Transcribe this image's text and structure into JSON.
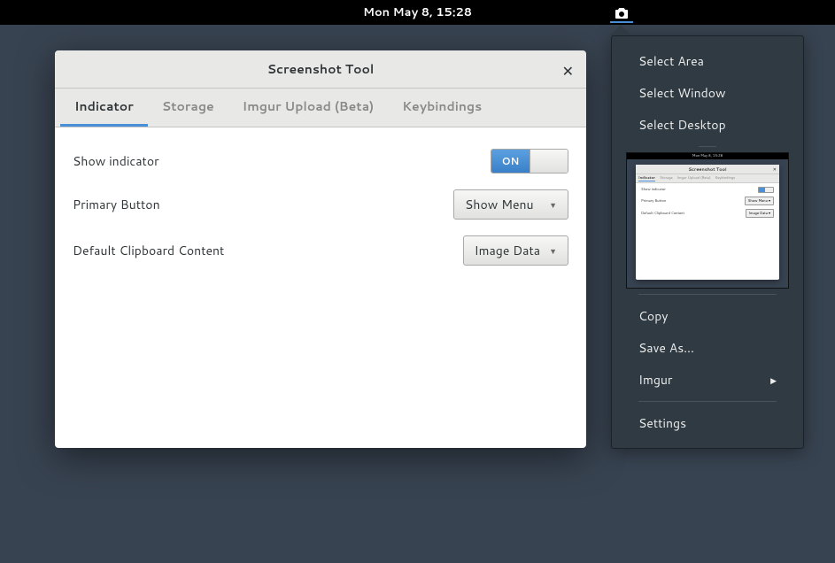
{
  "topbar": {
    "datetime": "Mon May  8, 15:28"
  },
  "window": {
    "title": "Screenshot Tool",
    "tabs": [
      {
        "label": "Indicator",
        "active": true
      },
      {
        "label": "Storage",
        "active": false
      },
      {
        "label": "Imgur Upload (Beta)",
        "active": false
      },
      {
        "label": "Keybindings",
        "active": false
      }
    ],
    "rows": {
      "show_indicator": {
        "label": "Show indicator",
        "value": "ON"
      },
      "primary_button": {
        "label": "Primary Button",
        "value": "Show Menu"
      },
      "clipboard": {
        "label": "Default Clipboard Content",
        "value": "Image Data"
      }
    }
  },
  "popup": {
    "select_area": "Select Area",
    "select_window": "Select Window",
    "select_desktop": "Select Desktop",
    "copy": "Copy",
    "save_as": "Save As...",
    "imgur": "Imgur",
    "settings": "Settings",
    "preview": {
      "datetime": "Mon May 8, 15:28",
      "title": "Screenshot Tool",
      "tabs": [
        "Indicator",
        "Storage",
        "Imgur Upload (Beta)",
        "Keybindings"
      ],
      "rows": {
        "r1": "Show indicator",
        "r2": "Primary Button",
        "r2v": "Show Menu ▾",
        "r3": "Default Clipboard Content",
        "r3v": "Image Data ▾"
      }
    }
  }
}
